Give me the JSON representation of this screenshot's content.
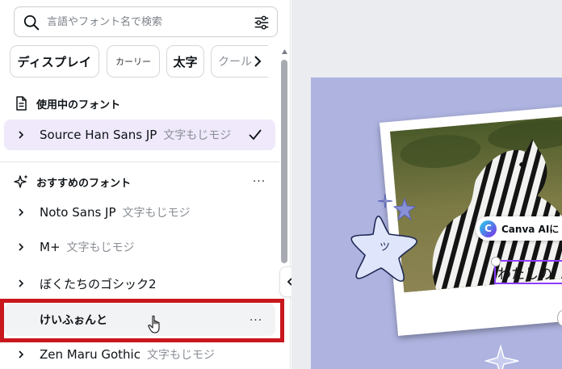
{
  "search": {
    "placeholder": "言語やフォント名で検索"
  },
  "chips": {
    "items": [
      "ディスプレイ",
      "カーリー",
      "太字",
      "クール"
    ]
  },
  "current_fonts": {
    "title": "使用中のフォント",
    "items": [
      {
        "name": "Source Han Sans JP",
        "sample": "文字もじモジ",
        "selected": true
      }
    ]
  },
  "recommended_fonts": {
    "title": "おすすめのフォント",
    "more_label": "···",
    "items": [
      {
        "name": "Noto Sans JP",
        "sample": "文字もじモジ"
      },
      {
        "name": "M+",
        "sample": "文字もじモジ"
      },
      {
        "name": "ぼくたちのゴシック2",
        "sample": ""
      },
      {
        "name": "けいふぉんと",
        "sample": "",
        "more_label": "···"
      },
      {
        "name": "Zen Maru Gothic",
        "sample": "文字もじモジ"
      }
    ]
  },
  "canvas": {
    "ai_label": "Canva AIに",
    "ai_logo_letter": "C",
    "text_box": "わたしの",
    "star_text": "ツ"
  },
  "colors": {
    "accent": "#8b3dff",
    "highlight": "#c8171d",
    "design_bg": "#aeb3e0",
    "selected_row": "#efe9fb"
  }
}
